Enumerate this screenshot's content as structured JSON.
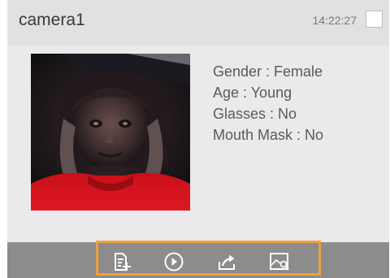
{
  "card": {
    "camera_name": "camera1",
    "timestamp": "14:22:27",
    "selected": false
  },
  "snapshot": {
    "alt": "face snapshot"
  },
  "attributes": [
    {
      "label": "Gender",
      "value": "Female",
      "text": "Gender : Female"
    },
    {
      "label": "Age",
      "value": "Young",
      "text": "Age : Young"
    },
    {
      "label": "Glasses",
      "value": "No",
      "text": "Glasses : No"
    },
    {
      "label": "Mouth Mask",
      "value": "No",
      "text": "Mouth Mask : No"
    }
  ],
  "toolbar": {
    "buttons": [
      {
        "icon": "add-to-list-icon"
      },
      {
        "icon": "play-icon"
      },
      {
        "icon": "export-icon"
      },
      {
        "icon": "image-search-icon"
      }
    ]
  },
  "colors": {
    "highlight": "#f0a040",
    "toolbar_bg": "#8c8c8c",
    "header_bg": "#e1e1e1",
    "card_bg": "#eaeaea"
  }
}
